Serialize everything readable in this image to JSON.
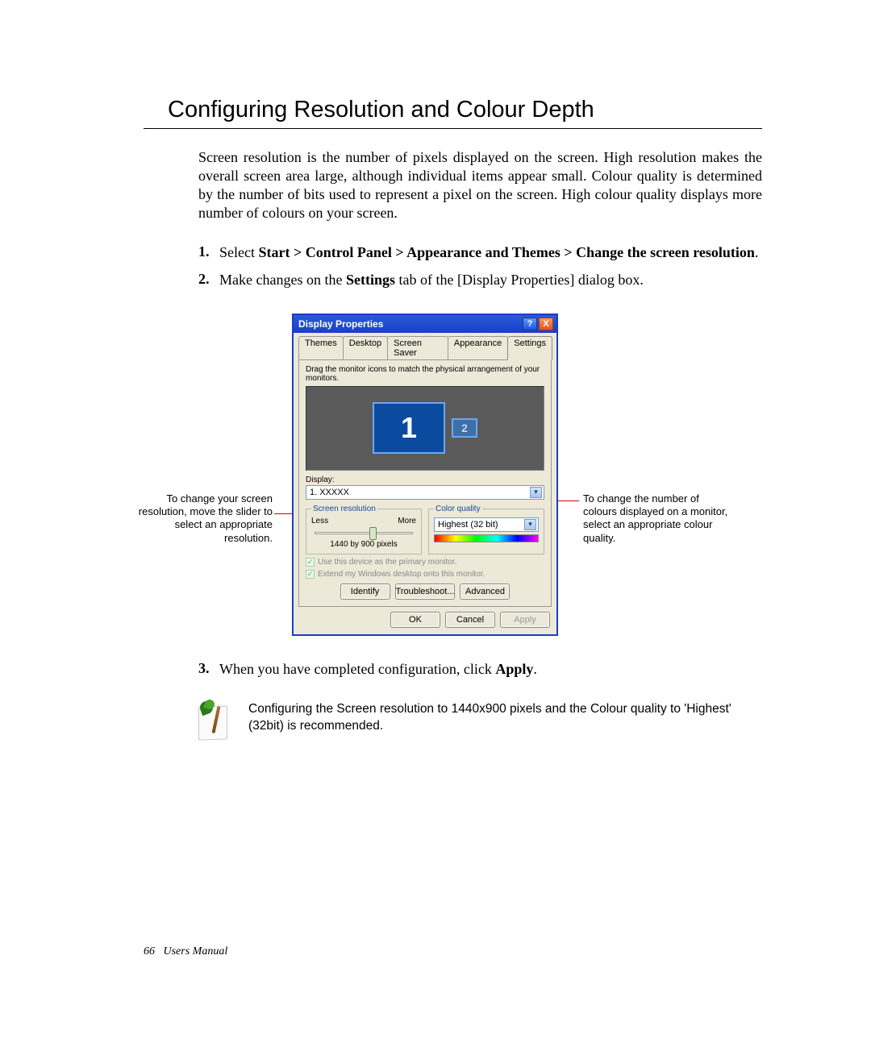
{
  "title": "Configuring Resolution and Colour Depth",
  "intro": "Screen resolution is the number of pixels displayed on the screen. High resolution makes the overall screen area large, although individual items appear small. Colour quality is determined by the number of bits used to represent a pixel on the screen. High colour quality displays more number of colours on your screen.",
  "steps": {
    "s1_pre": "Select ",
    "s1_bold": "Start > Control Panel > Appearance and Themes > Change the screen resolution",
    "s1_post": ".",
    "s2_pre": "Make changes on the ",
    "s2_bold": "Settings",
    "s2_post": " tab of the [Display Properties] dialog box.",
    "s3_pre": "When you have completed configuration, click ",
    "s3_bold": "Apply",
    "s3_post": "."
  },
  "callouts": {
    "left": "To change your screen resolution, move the slider to select an appropriate resolution.",
    "right": "To change the number of colours displayed on a monitor, select an appropriate colour quality."
  },
  "dialog": {
    "title": "Display Properties",
    "help": "?",
    "close": "X",
    "tabs": [
      "Themes",
      "Desktop",
      "Screen Saver",
      "Appearance",
      "Settings"
    ],
    "active_tab": 4,
    "drag_text": "Drag the monitor icons to match the physical arrangement of your monitors.",
    "mon1": "1",
    "mon2": "2",
    "display_label": "Display:",
    "display_value": "1. XXXXX",
    "res_legend": "Screen resolution",
    "res_less": "Less",
    "res_more": "More",
    "res_value": "1440 by 900 pixels",
    "cq_legend": "Color quality",
    "cq_value": "Highest (32 bit)",
    "chk1": "Use this device as the primary monitor.",
    "chk2": "Extend my Windows desktop onto this monitor.",
    "btn_identify": "Identify",
    "btn_trouble": "Troubleshoot...",
    "btn_adv": "Advanced",
    "btn_ok": "OK",
    "btn_cancel": "Cancel",
    "btn_apply": "Apply"
  },
  "note": "Configuring the Screen resolution to 1440x900 pixels and the Colour quality to 'Highest' (32bit) is recommended.",
  "footer": {
    "page": "66",
    "label": "Users Manual"
  }
}
